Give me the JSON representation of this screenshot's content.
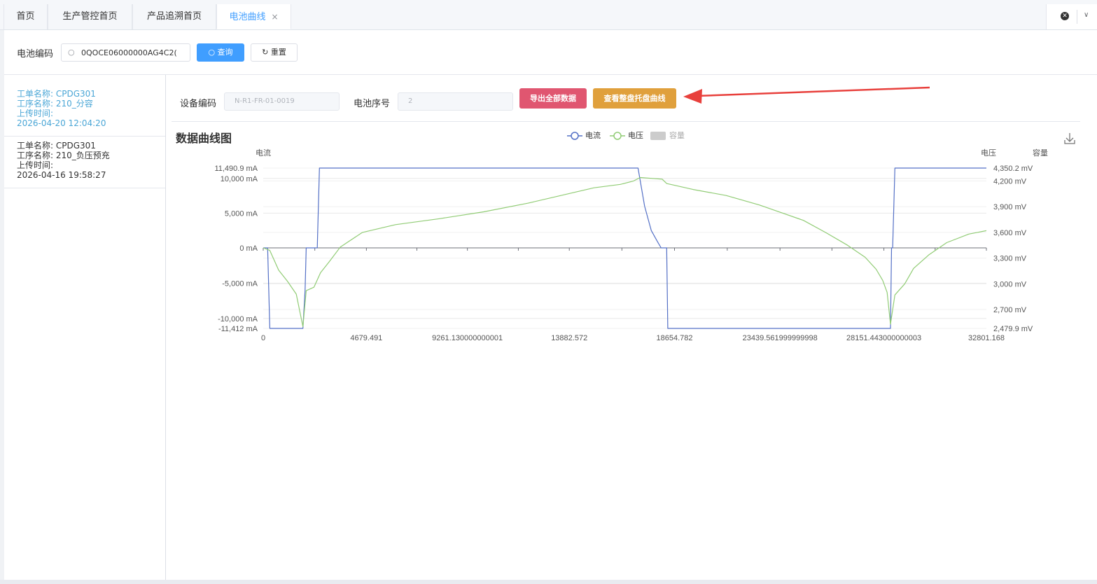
{
  "tabs": [
    {
      "label": "首页",
      "active": false,
      "closable": false
    },
    {
      "label": "生产管控首页",
      "active": false,
      "closable": false
    },
    {
      "label": "产品追溯首页",
      "active": false,
      "closable": false
    },
    {
      "label": "电池曲线",
      "active": true,
      "closable": true
    }
  ],
  "tab_close_glyph": "×",
  "search": {
    "label": "电池编码",
    "value": "0QOCE06000000AG4C2(",
    "query_button": "查询",
    "reset_button": "重置"
  },
  "records": [
    {
      "order": "工单名称: CPDG301",
      "process": "工序名称: 210_分容",
      "upload_label": "上传时间:",
      "upload_time": "2026-04-20 12:04:20",
      "active": true
    },
    {
      "order": "工单名称: CPDG301",
      "process": "工序名称: 210_负压预充",
      "upload_label": "上传时间:",
      "upload_time": "2026-04-16 19:58:27",
      "active": false
    }
  ],
  "filters": {
    "device_label": "设备编码",
    "device_value": "N-R1-FR-01-0019",
    "cell_label": "电池序号",
    "cell_value": "2",
    "export_button": "导出全部数据",
    "tray_button": "查看整盘托盘曲线"
  },
  "chart_data": {
    "type": "line",
    "title": "数据曲线图",
    "legend": [
      "电流",
      "电压",
      "容量"
    ],
    "legend_colors": {
      "电流": "#5470c6",
      "电压": "#91cc75",
      "容量": "#cccccc"
    },
    "legend_position": "top-center",
    "left_axis_name": "电流",
    "right_axis_names": [
      "电压",
      "容量"
    ],
    "x_ticks": [
      "0",
      "4679.491",
      "9261.130000000001",
      "13882.572",
      "18654.782",
      "23439.561999999998",
      "28151.443000000003",
      "32801.168"
    ],
    "x_range": [
      0,
      32801.168
    ],
    "y_left_ticks": [
      "11,490.9 mA",
      "10,000 mA",
      "5,000 mA",
      "0 mA",
      "-5,000 mA",
      "-10,000 mA",
      "-11,412 mA"
    ],
    "y_left_range": [
      -11412,
      11490.9
    ],
    "y_right_ticks": [
      "4,350.2 mV",
      "4,200 mV",
      "3,900 mV",
      "3,600 mV",
      "3,300 mV",
      "3,000 mV",
      "2,700 mV",
      "2,479.9 mV"
    ],
    "y_right_range": [
      2479.9,
      4350.2
    ],
    "series": [
      {
        "name": "电流",
        "unit": "mA",
        "points": [
          [
            0,
            0
          ],
          [
            200,
            0
          ],
          [
            300,
            -11412
          ],
          [
            1800,
            -11412
          ],
          [
            1900,
            -6000
          ],
          [
            1950,
            0
          ],
          [
            2450,
            0
          ],
          [
            2550,
            11490.9
          ],
          [
            17000,
            11490.9
          ],
          [
            17300,
            6000
          ],
          [
            17600,
            2500
          ],
          [
            17900,
            800
          ],
          [
            18050,
            0
          ],
          [
            18300,
            0
          ],
          [
            18350,
            -11412
          ],
          [
            28450,
            -11412
          ],
          [
            28500,
            0
          ],
          [
            28550,
            0
          ],
          [
            28650,
            11490.9
          ],
          [
            36650,
            11490.9
          ],
          [
            36850,
            7000
          ],
          [
            37150,
            3000
          ],
          [
            37350,
            800
          ],
          [
            37450,
            0
          ]
        ]
      },
      {
        "name": "电压",
        "unit": "mV",
        "points": [
          [
            0,
            3420
          ],
          [
            300,
            3390
          ],
          [
            700,
            3160
          ],
          [
            1100,
            3030
          ],
          [
            1500,
            2880
          ],
          [
            1800,
            2500
          ],
          [
            1950,
            2920
          ],
          [
            2300,
            2960
          ],
          [
            2600,
            3130
          ],
          [
            3000,
            3260
          ],
          [
            3500,
            3430
          ],
          [
            4500,
            3600
          ],
          [
            6000,
            3690
          ],
          [
            8000,
            3760
          ],
          [
            10000,
            3840
          ],
          [
            12000,
            3940
          ],
          [
            13500,
            4030
          ],
          [
            15000,
            4120
          ],
          [
            16200,
            4160
          ],
          [
            16800,
            4200
          ],
          [
            17100,
            4240
          ],
          [
            17600,
            4230
          ],
          [
            18100,
            4220
          ],
          [
            18300,
            4170
          ],
          [
            19500,
            4100
          ],
          [
            21000,
            4030
          ],
          [
            22500,
            3920
          ],
          [
            23500,
            3830
          ],
          [
            24500,
            3740
          ],
          [
            25500,
            3600
          ],
          [
            26500,
            3450
          ],
          [
            27300,
            3310
          ],
          [
            27800,
            3170
          ],
          [
            28100,
            3040
          ],
          [
            28300,
            2900
          ],
          [
            28450,
            2530
          ],
          [
            28650,
            2870
          ],
          [
            29100,
            3000
          ],
          [
            29500,
            3180
          ],
          [
            30200,
            3340
          ],
          [
            31000,
            3480
          ],
          [
            32000,
            3580
          ],
          [
            34000,
            3680
          ],
          [
            35500,
            3780
          ],
          [
            36300,
            3860
          ],
          [
            36900,
            3910
          ],
          [
            37400,
            3900
          ],
          [
            37600,
            3880
          ]
        ]
      }
    ]
  }
}
